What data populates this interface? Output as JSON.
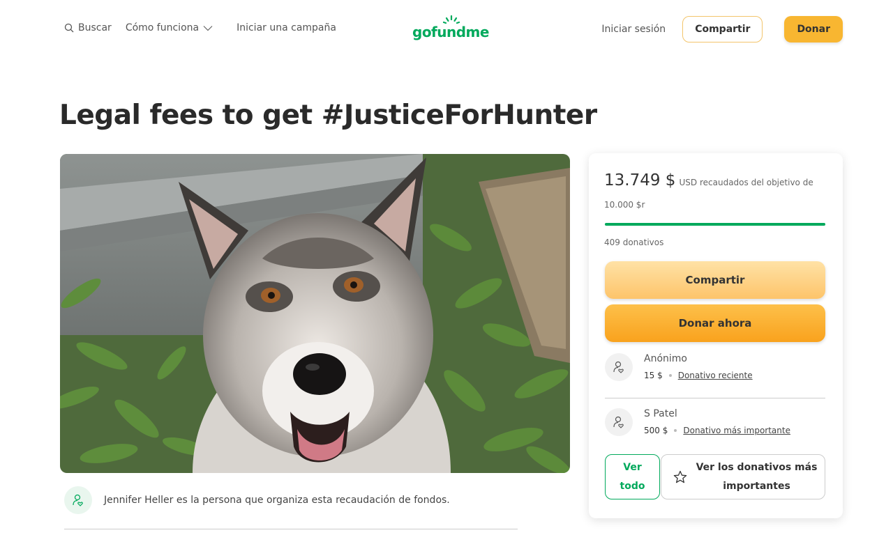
{
  "nav": {
    "search_label": "Buscar",
    "how_it_works_label": "Cómo funciona",
    "start_campaign_label": "Iniciar una campaña",
    "logo_text": "gofundme",
    "login_label": "Iniciar sesión",
    "share_label": "Compartir",
    "donate_label": "Donar"
  },
  "campaign": {
    "title": "Legal fees to get #JusticeForHunter",
    "organizer_text": "Jennifer Heller es la persona que organiza esta recaudación de fondos."
  },
  "card": {
    "amount_raised": "13.749 $",
    "raised_label": "USD recaudados del objetivo de",
    "goal": "10.000 $r",
    "progress_fraction": 1.0,
    "donation_count": "409 donativos",
    "share_label": "Compartir",
    "donate_label": "Donar ahora",
    "donors": [
      {
        "name": "Anónimo",
        "amount": "15 $",
        "tag": "Donativo reciente"
      },
      {
        "name": "S Patel",
        "amount": "500 $",
        "tag": "Donativo más importante"
      }
    ],
    "see_all_label": "Ver todo",
    "top_donations_label": "Ver los donativos más importantes"
  },
  "colors": {
    "brand_green": "#02a95c",
    "donate_orange": "#f8b631"
  }
}
